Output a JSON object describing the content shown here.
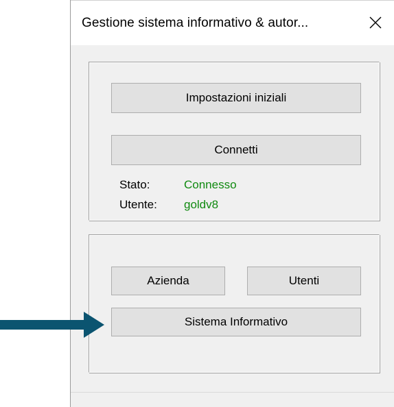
{
  "window": {
    "title": "Gestione sistema informativo & autor...",
    "close_label": "✕"
  },
  "connection": {
    "initial_settings_label": "Impostazioni iniziali",
    "connect_label": "Connetti",
    "status_label": "Stato:",
    "status_value": "Connesso",
    "user_label": "Utente:",
    "user_value": "goldv8"
  },
  "management": {
    "company_label": "Azienda",
    "users_label": "Utenti",
    "information_system_label": "Sistema Informativo"
  },
  "colors": {
    "status_value": "#108a10",
    "arrow": "#0b5470"
  },
  "annotation": {
    "pointer_icon": "right-arrow-icon"
  }
}
